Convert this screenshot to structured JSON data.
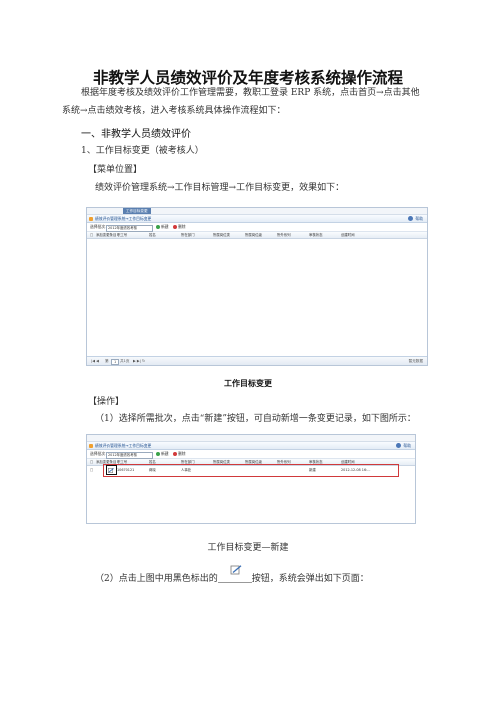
{
  "doc": {
    "title": "非教学人员绩效评价及年度考核系统操作流程",
    "intro_line1": "根据年度考核及绩效评价工作管理需要，教职工登录 ERP 系统，点击首页→点击其他",
    "intro_line2": "系统→点击绩效考核，进入考核系统具体操作流程如下：",
    "section1": "一、非教学人员绩效评价",
    "item1": "1、工作目标变更（被考核人）",
    "menu_heading": "【菜单位置】",
    "menu_path": "绩效评价管理系统→工作目标管理→工作目标变更，效果如下：",
    "caption1": "工作目标变更",
    "op_heading": "【操作】",
    "step1": "（1）选择所需批次，点击“新建”按钮，可自动新增一条变更记录，如下图所示：",
    "caption2": "工作目标变更—新建",
    "step2_prefix": "（2）点击上图中用黑色标出的",
    "step2_suffix": "按钮，系统会弹出如下页面："
  },
  "screens": {
    "tab_label": "工作目标变更",
    "crumb": "绩效评价管理系统→工作目标变更",
    "help": "帮助",
    "batch_label": "选择批次：",
    "batch_value": "2012年度绩效考核",
    "new_label": "新建",
    "delete_label": "删除",
    "columns": [
      "添加变更条目",
      "职工号",
      "姓名",
      "所在部门",
      "所属岗位类",
      "所属岗位级",
      "所外系列",
      "审核状态",
      "创建时间"
    ],
    "pager_page": "第",
    "pager_page_value": "1",
    "pager_total": "共1页",
    "pager_info": "暂无数据",
    "row": {
      "emp_no": "10670121",
      "name": "蒋晓",
      "dept": "人事处",
      "status": "新建",
      "created": "2012-12-08 16:..."
    }
  }
}
